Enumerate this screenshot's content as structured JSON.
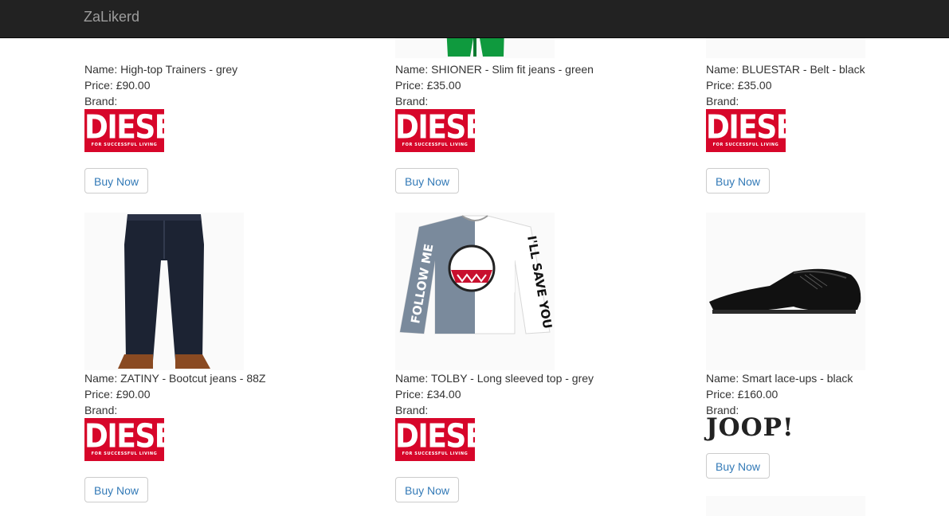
{
  "navbar": {
    "brand": "ZaLikerd"
  },
  "labels": {
    "name_prefix": "Name: ",
    "price_prefix": "Price: ",
    "brand": "Brand:"
  },
  "products": [
    {
      "name": "High-top Trainers - grey",
      "price": "£90.00",
      "brand_logo": "DIESEL",
      "brand_tagline": "FOR SUCCESSFUL LIVING",
      "buy_label": "Buy Now",
      "image": "trainers"
    },
    {
      "name": "SHIONER - Slim fit jeans - green",
      "price": "£35.00",
      "brand_logo": "DIESEL",
      "brand_tagline": "FOR SUCCESSFUL LIVING",
      "buy_label": "Buy Now",
      "image": "green-jeans"
    },
    {
      "name": "BLUESTAR - Belt - black",
      "price": "£35.00",
      "brand_logo": "DIESEL",
      "brand_tagline": "FOR SUCCESSFUL LIVING",
      "buy_label": "Buy Now",
      "image": "belt"
    },
    {
      "name": "ZATINY - Bootcut jeans - 88Z",
      "price": "£90.00",
      "brand_logo": "DIESEL",
      "brand_tagline": "FOR SUCCESSFUL LIVING",
      "buy_label": "Buy Now",
      "image": "dark-jeans"
    },
    {
      "name": "TOLBY - Long sleeved top - grey",
      "price": "£34.00",
      "brand_logo": "DIESEL",
      "brand_tagline": "FOR SUCCESSFUL LIVING",
      "buy_label": "Buy Now",
      "image": "sleeved-top",
      "shirt_text": {
        "left_sleeve": "FOLLOW ME",
        "right_sleeve": "I'LL SAVE YOU"
      }
    },
    {
      "name": "Smart lace-ups - black",
      "price": "£160.00",
      "brand_logo": "JOOP!",
      "buy_label": "Buy Now",
      "image": "black-shoe"
    }
  ],
  "colors": {
    "navbar_bg": "#222222",
    "brand_text": "#9d9d9d",
    "link": "#337ab7",
    "diesel_red": "#d7062a"
  }
}
